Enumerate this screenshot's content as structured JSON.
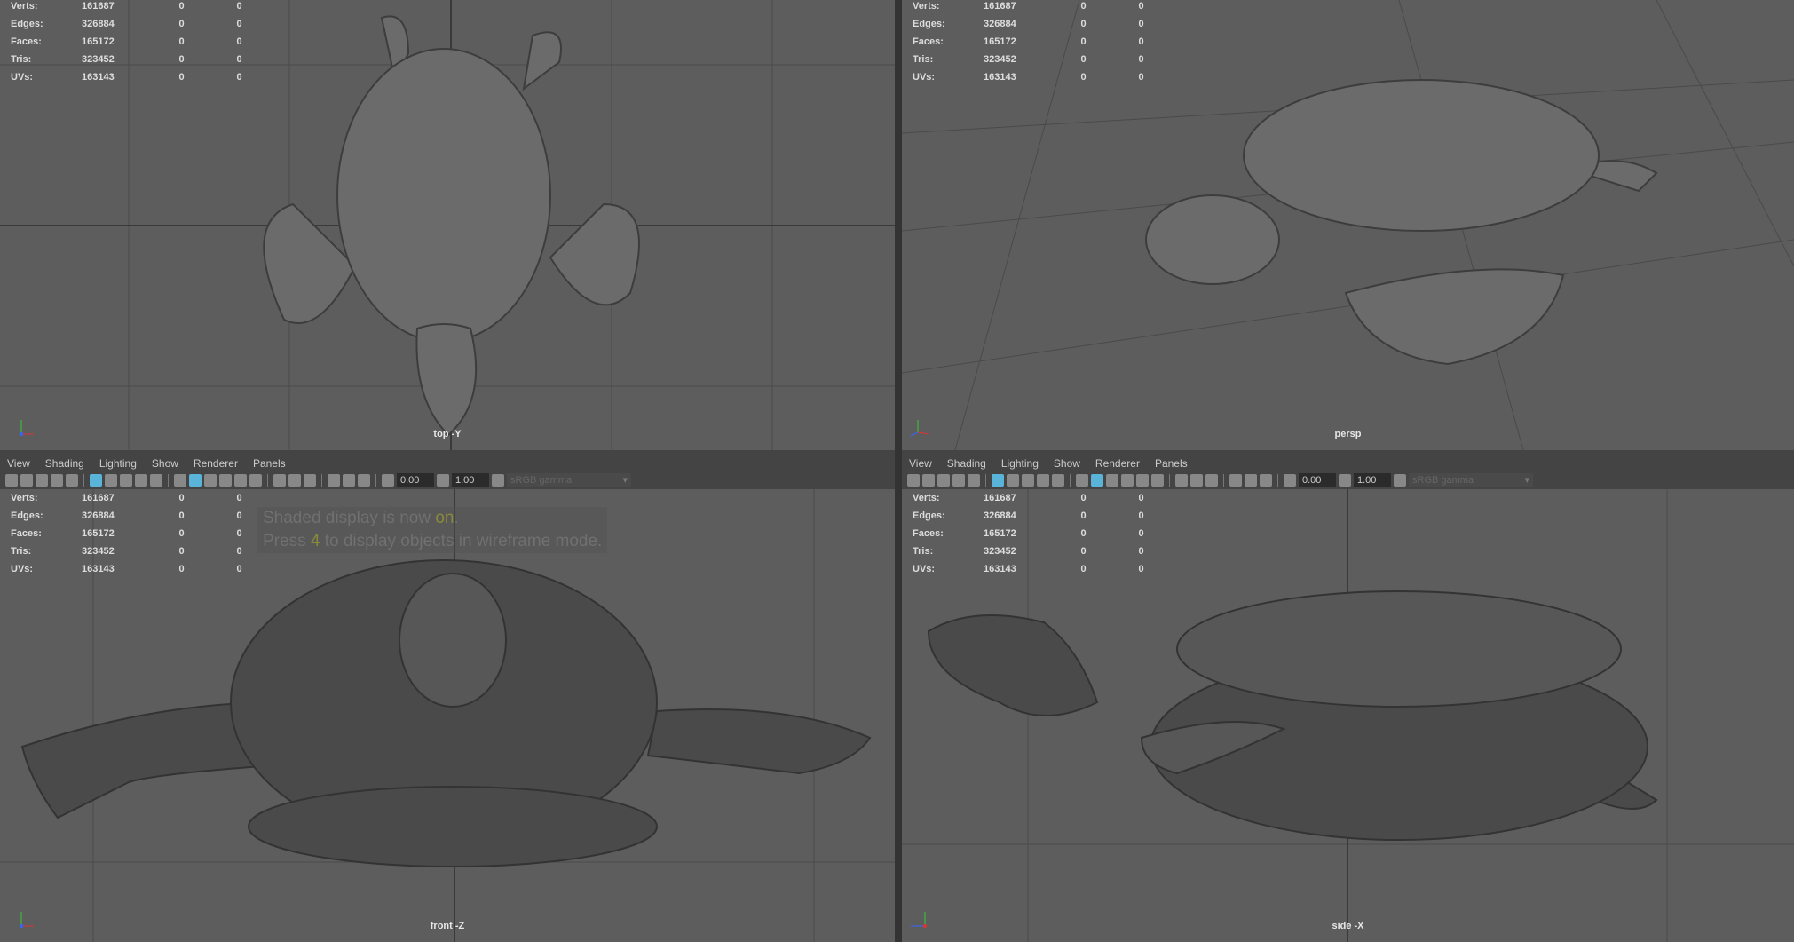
{
  "stats": {
    "rows": [
      {
        "label": "Verts:",
        "value": "161687",
        "a": "0",
        "b": "0"
      },
      {
        "label": "Edges:",
        "value": "326884",
        "a": "0",
        "b": "0"
      },
      {
        "label": "Faces:",
        "value": "165172",
        "a": "0",
        "b": "0"
      },
      {
        "label": "Tris:",
        "value": "323452",
        "a": "0",
        "b": "0"
      },
      {
        "label": "UVs:",
        "value": "163143",
        "a": "0",
        "b": "0"
      }
    ]
  },
  "menu": [
    "View",
    "Shading",
    "Lighting",
    "Show",
    "Renderer",
    "Panels"
  ],
  "toolbar": {
    "exposure": "0.00",
    "gamma": "1.00",
    "color_space": "sRGB gamma"
  },
  "viewports": {
    "top": "top -Y",
    "persp": "persp",
    "front": "front -Z",
    "side": "side -X"
  },
  "hud": {
    "line1_a": "Shaded display is now ",
    "line1_b": "on",
    "line1_c": ".",
    "line2_a": "Press ",
    "line2_b": "4",
    "line2_c": " to display objects in wireframe mode."
  }
}
